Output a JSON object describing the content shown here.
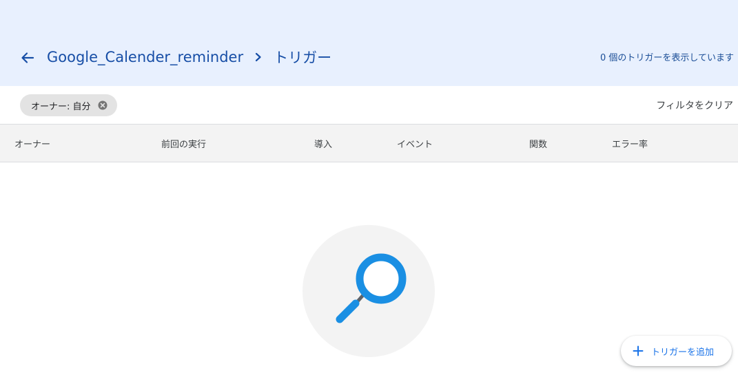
{
  "header": {
    "project_name": "Google_Calender_reminder",
    "current_page": "トリガー",
    "trigger_count_text": "0 個のトリガーを表示しています",
    "background_color": "#e8f0fe",
    "title_color": "#174ea6"
  },
  "filter": {
    "chip_label": "オーナー: 自分",
    "clear_label": "フィルタをクリア"
  },
  "table": {
    "columns": [
      "オーナー",
      "前回の実行",
      "導入",
      "イベント",
      "関数",
      "エラー率"
    ]
  },
  "empty_state": {
    "icon": "magnifier-icon",
    "icon_color": "#1a8fe3"
  },
  "actions": {
    "add_trigger_label": "トリガーを追加",
    "accent_color": "#1a73e8"
  }
}
